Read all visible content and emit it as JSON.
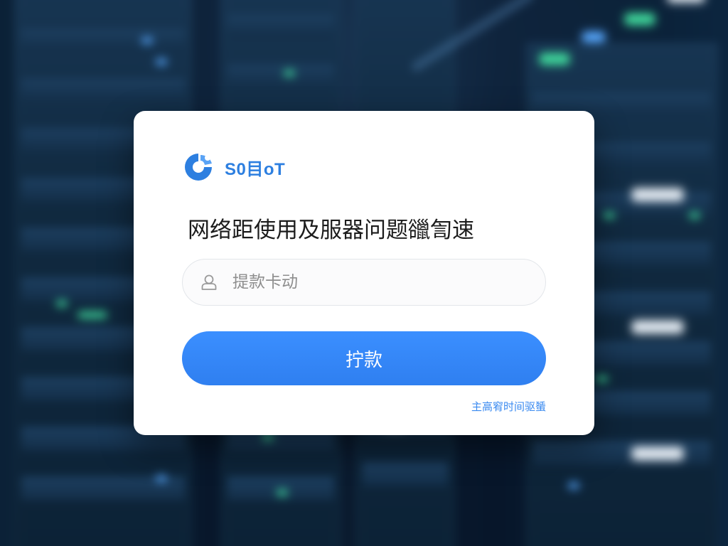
{
  "brand": {
    "name": "S0目oT",
    "logo_icon": "brand-swirl-icon",
    "color": "#2d7fe0"
  },
  "dialog": {
    "heading": "网络距使用及服器问题䜲訇速",
    "input": {
      "placeholder": "提款卡动",
      "value": "",
      "icon": "user-icon"
    },
    "submit_label": "拧款",
    "footer_link": "主高䆜时间驱蜑"
  },
  "colors": {
    "accent": "#2f7ff0",
    "card_background": "#ffffff",
    "backdrop": "#061426"
  }
}
